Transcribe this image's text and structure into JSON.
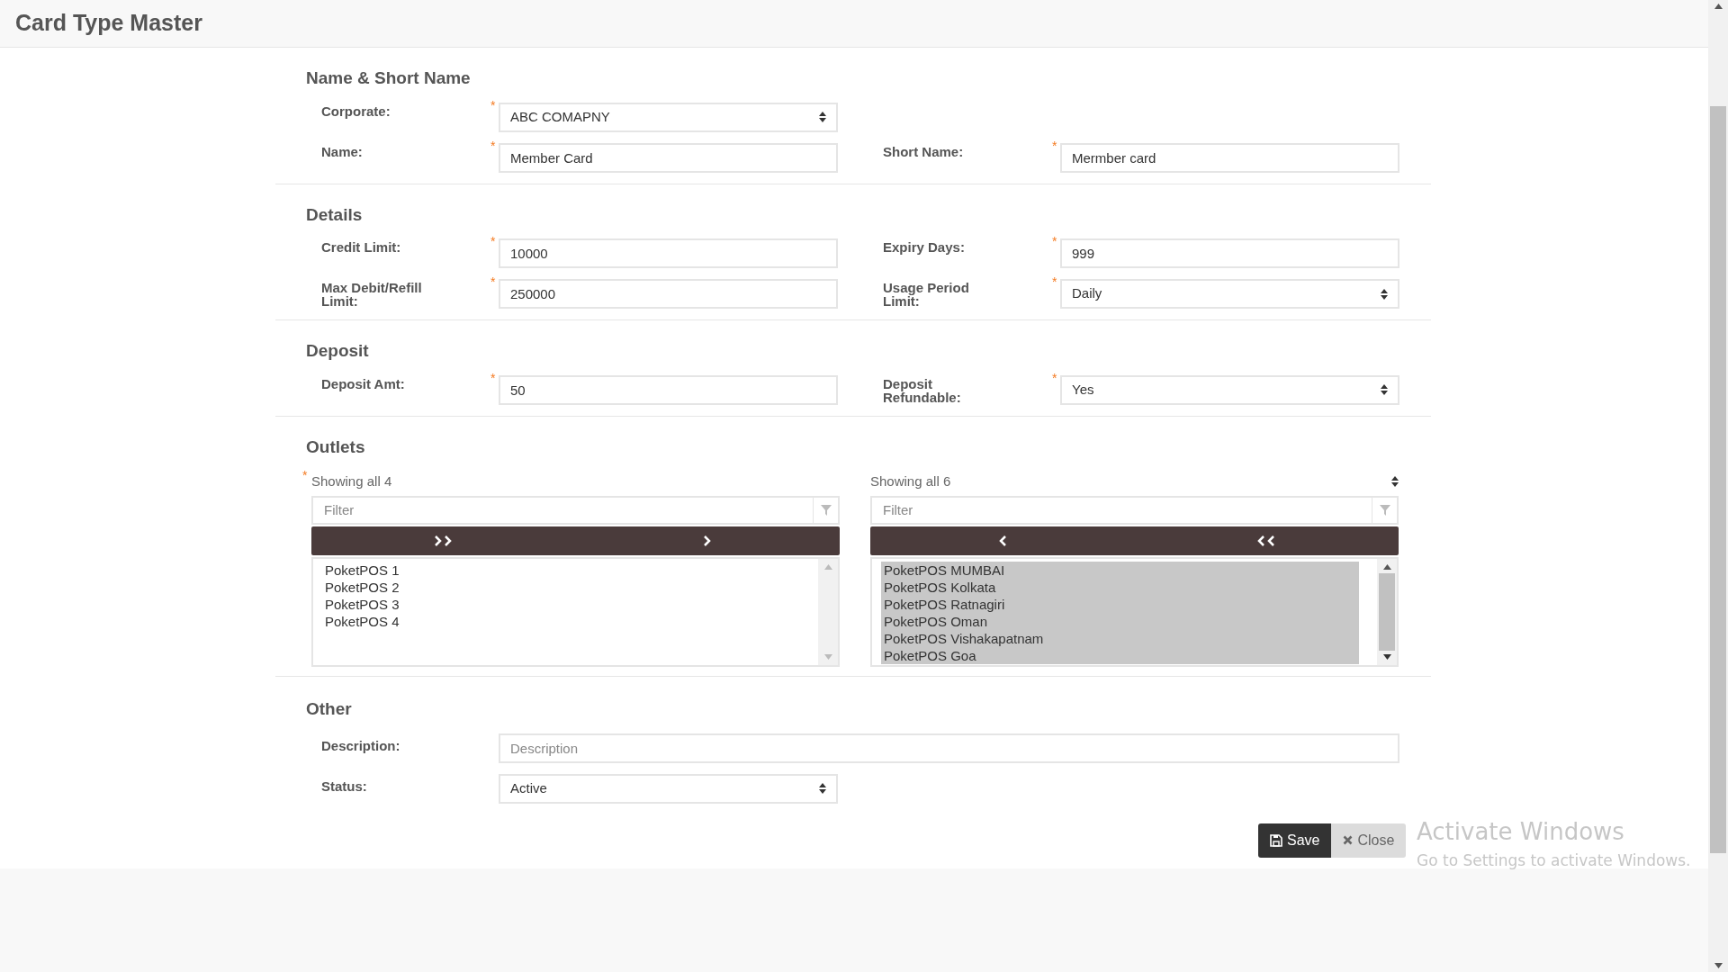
{
  "page_title": "Card Type Master",
  "sections": [
    {
      "heading": "Name & Short Name",
      "rows": [
        [
          {
            "label": "Corporate:",
            "required": "*",
            "kind": "select",
            "value": "ABC COMAPNY"
          }
        ],
        [
          {
            "label": "Name:",
            "required": "*",
            "kind": "text",
            "value": "Member Card"
          },
          {
            "label": "Short Name:",
            "required": "*",
            "kind": "text",
            "value": "Mermber card"
          }
        ]
      ]
    },
    {
      "heading": "Details",
      "rows": [
        [
          {
            "label": "Credit Limit:",
            "required": "*",
            "kind": "text",
            "value": "10000"
          },
          {
            "label": "Expiry Days:",
            "required": "*",
            "kind": "text",
            "value": "999"
          }
        ],
        [
          {
            "label": "Max Debit/Refill Limit:",
            "required": "*",
            "kind": "text",
            "value": "250000"
          },
          {
            "label": "Usage Period Limit:",
            "required": "*",
            "kind": "select",
            "value": "Daily"
          }
        ]
      ]
    },
    {
      "heading": "Deposit",
      "rows": [
        [
          {
            "label": "Deposit Amt:",
            "required": "*",
            "kind": "text",
            "value": "50"
          },
          {
            "label": "Deposit Refundable:",
            "required": "*",
            "kind": "select",
            "value": "Yes"
          }
        ]
      ]
    }
  ],
  "outlets": {
    "heading": "Outlets",
    "required": "*",
    "available": {
      "info": "Showing all 4",
      "filter_placeholder": "Filter",
      "items": [
        {
          "label": "PoketPOS 1",
          "selected": false
        },
        {
          "label": "PoketPOS 2",
          "selected": false
        },
        {
          "label": "PoketPOS 3",
          "selected": false
        },
        {
          "label": "PoketPOS 4",
          "selected": false
        }
      ]
    },
    "chosen": {
      "info": "Showing all 6",
      "filter_placeholder": "Filter",
      "items": [
        {
          "label": "PoketPOS MUMBAI",
          "selected": true
        },
        {
          "label": "PoketPOS Kolkata",
          "selected": true
        },
        {
          "label": "PoketPOS Ratnagiri",
          "selected": true
        },
        {
          "label": "PoketPOS Oman",
          "selected": true
        },
        {
          "label": "PoketPOS Vishakapatnam",
          "selected": true
        },
        {
          "label": "PoketPOS Goa",
          "selected": true
        }
      ]
    }
  },
  "other": {
    "heading": "Other",
    "description": {
      "label": "Description:",
      "placeholder": "Description"
    },
    "status": {
      "label": "Status:",
      "kind": "select",
      "value": "Active"
    }
  },
  "buttons": [
    {
      "kind": "save",
      "label": "Save"
    },
    {
      "kind": "close",
      "label": "Close"
    }
  ],
  "os_notice": {
    "title": "Activate Windows",
    "message": "Go to Settings to activate Windows."
  }
}
